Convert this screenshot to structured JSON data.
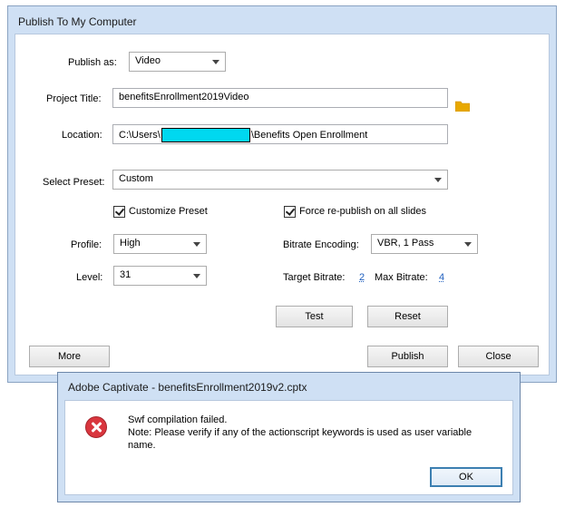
{
  "main_window": {
    "title": "Publish To My Computer",
    "publish_as": {
      "label": "Publish as:",
      "value": "Video"
    },
    "project_title": {
      "label": "Project Title:",
      "value": "benefitsEnrollment2019Video"
    },
    "location": {
      "label": "Location:",
      "prefix": "C:\\Users\\",
      "suffix": "\\Benefits Open Enrollment"
    },
    "select_preset": {
      "label": "Select Preset:",
      "value": "Custom"
    },
    "customize_preset": {
      "label": "Customize Preset",
      "checked": true
    },
    "force_republish": {
      "label": "Force re-publish on all slides",
      "checked": true
    },
    "profile": {
      "label": "Profile:",
      "value": "High"
    },
    "bitrate_encoding": {
      "label": "Bitrate Encoding:",
      "value": "VBR, 1 Pass"
    },
    "level": {
      "label": "Level:",
      "value": "31"
    },
    "target_bitrate": {
      "label": "Target Bitrate:",
      "value": "2"
    },
    "max_bitrate": {
      "label": "Max Bitrate:",
      "value": "4"
    },
    "buttons": {
      "test": "Test",
      "reset": "Reset",
      "more": "More",
      "publish": "Publish",
      "close": "Close"
    },
    "colors": {
      "redaction": "#00d8f0",
      "folder": "#e8a800"
    }
  },
  "error_dialog": {
    "title": "Adobe Captivate - benefitsEnrollment2019v2.cptx",
    "line1": "Swf compilation failed.",
    "line2": "Note: Please verify if any of the actionscript keywords is used as user variable",
    "line3": "name.",
    "ok": "OK",
    "icon": "error-icon"
  }
}
